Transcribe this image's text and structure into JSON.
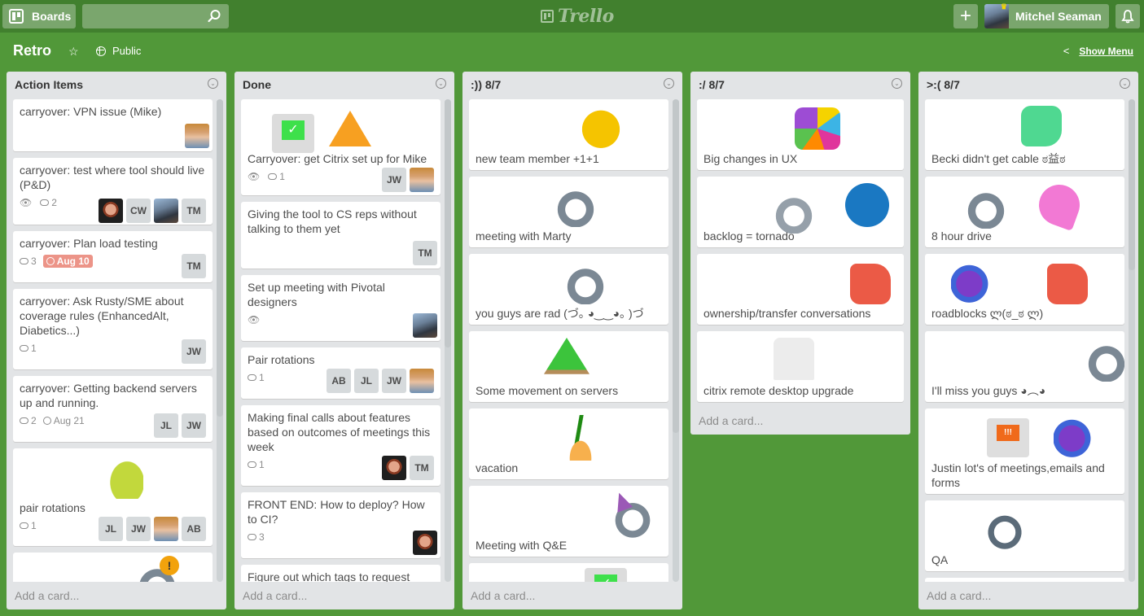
{
  "header": {
    "boards_label": "Boards",
    "search_value": "",
    "logo_text": "Trello",
    "add_label": "+",
    "user_name": "Mitchel Seaman"
  },
  "board": {
    "title": "Retro",
    "visibility": "Public",
    "show_menu_label": "Show Menu"
  },
  "colors": {
    "header_bg": "#41802e",
    "board_bg": "#519839",
    "due_badge": "#ec9488",
    "list_bg": "#e2e4e6"
  },
  "lists": [
    {
      "title": "Action Items",
      "add_card": "Add a card...",
      "cards": [
        {
          "title": "carryover: VPN issue (Mike)",
          "members": [
            "photo-mike"
          ]
        },
        {
          "title": "carryover: test where tool should live (P&D)",
          "watch": true,
          "comments": "2",
          "members": [
            "photo-woman",
            "CW",
            "photo-mitchel",
            "TM"
          ]
        },
        {
          "title": "carryover: Plan load testing",
          "comments": "3",
          "due": "Aug 10",
          "due_overdue": true,
          "members": [
            "TM"
          ]
        },
        {
          "title": "carryover: Ask Rusty/SME about coverage rules (EnhancedAlt, Diabetics...)",
          "comments": "1",
          "members": [
            "JW"
          ]
        },
        {
          "title": "carryover: Getting backend servers up and running.",
          "comments": "2",
          "due": "Aug 21",
          "members": [
            "JL",
            "JW"
          ]
        },
        {
          "title": "pair rotations",
          "sticker": "pear",
          "comments": "1",
          "members": [
            "JL",
            "JW",
            "photo-mike",
            "AB"
          ]
        },
        {
          "title": "",
          "sticker": "husky-alert"
        }
      ]
    },
    {
      "title": "Done",
      "add_card": "Add a card...",
      "cards": [
        {
          "title": "Carryover: get Citrix set up for Mike",
          "sticker": "computer-check + warning",
          "watch": true,
          "comments": "1",
          "members": [
            "JW",
            "photo-mike"
          ]
        },
        {
          "title": "Giving the tool to CS reps without talking to them yet",
          "members": [
            "TM"
          ]
        },
        {
          "title": "Set up meeting with Pivotal designers",
          "watch": true,
          "members": [
            "photo-mitchel"
          ]
        },
        {
          "title": "Pair rotations",
          "comments": "1",
          "members": [
            "AB",
            "JL",
            "JW",
            "photo-mike"
          ]
        },
        {
          "title": "Making final calls about features based on outcomes of meetings this week",
          "comments": "1",
          "members": [
            "photo-woman",
            "TM"
          ]
        },
        {
          "title": "FRONT END: How to deploy? How to CI?",
          "comments": "3",
          "members": [
            "photo-woman"
          ]
        },
        {
          "title": "Figure out which tags to request"
        }
      ]
    },
    {
      "title": ":)) 8/7",
      "add_card": "Add a card...",
      "cards": [
        {
          "title": "new team member +1+1",
          "sticker": "gold-fox"
        },
        {
          "title": "meeting with Marty",
          "sticker": "husky-sunglasses"
        },
        {
          "title": "you guys are rad (づ｡ ◕‿‿◕｡ )づ",
          "sticker": "husky-headband"
        },
        {
          "title": "Some movement on servers",
          "sticker": "trees-server"
        },
        {
          "title": "vacation",
          "sticker": "palm-tree"
        },
        {
          "title": "Meeting with Q&E",
          "sticker": "husky-party"
        },
        {
          "title": "",
          "sticker": "computer-check"
        }
      ]
    },
    {
      "title": ":/ 8/7",
      "add_card": "Add a card...",
      "cards": [
        {
          "title": "Big changes in UX",
          "sticker": "colorful-cards"
        },
        {
          "title": "backlog = tornado",
          "sticker": "husky-dizzy + winking-face"
        },
        {
          "title": "ownership/transfer conversations",
          "sticker": "thumbs-down"
        },
        {
          "title": "citrix remote desktop upgrade",
          "sticker": "boo-ghost-computer"
        }
      ]
    },
    {
      "title": ">:( 8/7",
      "add_card": "Add a card...",
      "cards": [
        {
          "title": "Becki didn't get cable ಠ益ಠ",
          "sticker": "thumbs-up"
        },
        {
          "title": "8 hour drive",
          "sticker": "husky-sleepy + rocket"
        },
        {
          "title": "roadblocks ლ(ಠ_ಠ ლ)",
          "sticker": "dragon + thumbs-down"
        },
        {
          "title": "I'll miss you guys ◕︵◕",
          "sticker": "husky-hearts"
        },
        {
          "title": "Justin lot's of meetings,emails and forms",
          "sticker": "computer-alert + dragon"
        },
        {
          "title": "QA",
          "sticker": "husky-pixel"
        },
        {
          "title": ""
        }
      ]
    }
  ]
}
